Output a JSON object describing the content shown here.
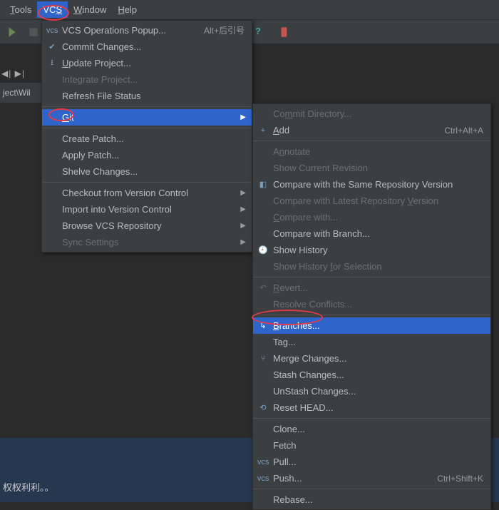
{
  "menubar": {
    "tools": "Tools",
    "vcs": "VCS",
    "window": "Window",
    "help": "Help"
  },
  "breadcrumb": "ject\\Wil",
  "status_text": "权权利利。。",
  "menu1": {
    "vcs_ops": "VCS Operations Popup...",
    "vcs_ops_sc": "Alt+后引号",
    "commit": "Commit Changes...",
    "update": "Update Project...",
    "integrate": "Integrate Project...",
    "refresh": "Refresh File Status",
    "git": "Git",
    "create_patch": "Create Patch...",
    "apply_patch": "Apply Patch...",
    "shelve": "Shelve Changes...",
    "checkout": "Checkout from Version Control",
    "import": "Import into Version Control",
    "browse": "Browse VCS Repository",
    "sync": "Sync Settings"
  },
  "menu2": {
    "commit_dir": "Commit Directory...",
    "add": "Add",
    "add_sc": "Ctrl+Alt+A",
    "annotate": "Annotate",
    "show_rev": "Show Current Revision",
    "cmp_same": "Compare with the Same Repository Version",
    "cmp_latest": "Compare with Latest Repository Version",
    "cmp_with": "Compare with...",
    "cmp_branch": "Compare with Branch...",
    "show_hist": "Show History",
    "show_hist_sel": "Show History for Selection",
    "revert": "Revert...",
    "resolve": "Resolve Conflicts...",
    "branches": "Branches...",
    "tag": "Tag...",
    "merge": "Merge Changes...",
    "stash": "Stash Changes...",
    "unstash": "UnStash Changes...",
    "reset": "Reset HEAD...",
    "clone": "Clone...",
    "fetch": "Fetch",
    "pull": "Pull...",
    "push": "Push...",
    "push_sc": "Ctrl+Shift+K",
    "rebase": "Rebase..."
  }
}
